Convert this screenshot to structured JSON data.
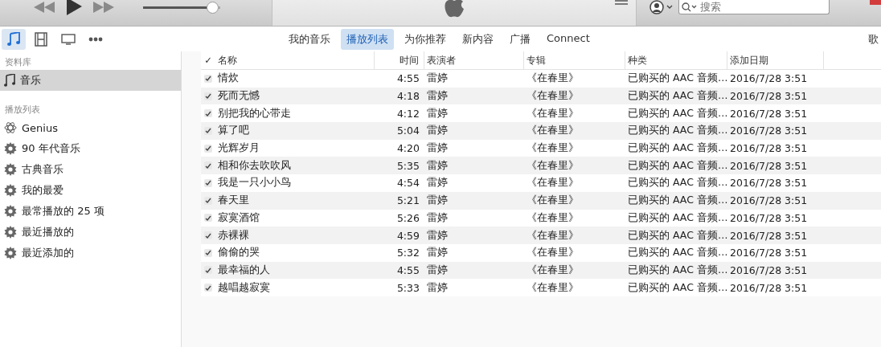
{
  "player": {
    "volume": {
      "level": 0.97
    }
  },
  "search": {
    "placeholder": "搜索"
  },
  "media_types": [
    {
      "kind": "music",
      "selected": true
    },
    {
      "kind": "movies",
      "selected": false
    },
    {
      "kind": "tv",
      "selected": false
    },
    {
      "kind": "more",
      "selected": false
    }
  ],
  "nav_tabs": [
    {
      "label": "我的音乐",
      "selected": false
    },
    {
      "label": "播放列表",
      "selected": true
    },
    {
      "label": "为你推荐",
      "selected": false
    },
    {
      "label": "新内容",
      "selected": false
    },
    {
      "label": "广播",
      "selected": false
    },
    {
      "label": "Connect",
      "selected": false
    }
  ],
  "nav_right": "歌",
  "sidebar": {
    "sections": [
      {
        "title": "资料库",
        "items": [
          {
            "label": "音乐",
            "kind": "music",
            "selected": true
          }
        ]
      },
      {
        "title": "播放列表",
        "items": [
          {
            "label": "Genius",
            "kind": "genius",
            "selected": false
          },
          {
            "label": "90 年代音乐",
            "kind": "smart",
            "selected": false
          },
          {
            "label": "古典音乐",
            "kind": "smart",
            "selected": false
          },
          {
            "label": "我的最爱",
            "kind": "smart",
            "selected": false
          },
          {
            "label": "最常播放的 25 项",
            "kind": "smart",
            "selected": false
          },
          {
            "label": "最近播放的",
            "kind": "smart",
            "selected": false
          },
          {
            "label": "最近添加的",
            "kind": "smart",
            "selected": false
          }
        ]
      }
    ]
  },
  "table": {
    "check_column": "✓",
    "columns": [
      "名称",
      "时间",
      "表演者",
      "专辑",
      "种类",
      "添加日期"
    ],
    "rows": [
      {
        "checked": true,
        "cells": [
          "情炊",
          "4:55",
          "雷婷",
          "《在春里》",
          "已购买的 AAC 音频…",
          "2016/7/28 3:51"
        ]
      },
      {
        "checked": true,
        "cells": [
          "死而无憾",
          "4:18",
          "雷婷",
          "《在春里》",
          "已购买的 AAC 音频…",
          "2016/7/28 3:51"
        ]
      },
      {
        "checked": true,
        "cells": [
          "别把我的心带走",
          "4:12",
          "雷婷",
          "《在春里》",
          "已购买的 AAC 音频…",
          "2016/7/28 3:51"
        ]
      },
      {
        "checked": true,
        "cells": [
          "算了吧",
          "5:04",
          "雷婷",
          "《在春里》",
          "已购买的 AAC 音频…",
          "2016/7/28 3:51"
        ]
      },
      {
        "checked": true,
        "cells": [
          "光辉岁月",
          "4:20",
          "雷婷",
          "《在春里》",
          "已购买的 AAC 音频…",
          "2016/7/28 3:51"
        ]
      },
      {
        "checked": true,
        "cells": [
          "相和你去吹吹风",
          "5:35",
          "雷婷",
          "《在春里》",
          "已购买的 AAC 音频…",
          "2016/7/28 3:51"
        ]
      },
      {
        "checked": true,
        "cells": [
          "我是一只小小鸟",
          "4:54",
          "雷婷",
          "《在春里》",
          "已购买的 AAC 音频…",
          "2016/7/28 3:51"
        ]
      },
      {
        "checked": true,
        "cells": [
          "春天里",
          "5:21",
          "雷婷",
          "《在春里》",
          "已购买的 AAC 音频…",
          "2016/7/28 3:51"
        ]
      },
      {
        "checked": true,
        "cells": [
          "寂寞酒馆",
          "5:26",
          "雷婷",
          "《在春里》",
          "已购买的 AAC 音频…",
          "2016/7/28 3:51"
        ]
      },
      {
        "checked": true,
        "cells": [
          "赤裸裸",
          "4:59",
          "雷婷",
          "《在春里》",
          "已购买的 AAC 音频…",
          "2016/7/28 3:51"
        ]
      },
      {
        "checked": true,
        "cells": [
          "偷偷的哭",
          "5:32",
          "雷婷",
          "《在春里》",
          "已购买的 AAC 音频…",
          "2016/7/28 3:51"
        ]
      },
      {
        "checked": true,
        "cells": [
          "最幸福的人",
          "4:55",
          "雷婷",
          "《在春里》",
          "已购买的 AAC 音频…",
          "2016/7/28 3:51"
        ]
      },
      {
        "checked": true,
        "cells": [
          "越唱越寂寞",
          "5:33",
          "雷婷",
          "《在春里》",
          "已购买的 AAC 音频…",
          "2016/7/28 3:51"
        ]
      }
    ]
  }
}
